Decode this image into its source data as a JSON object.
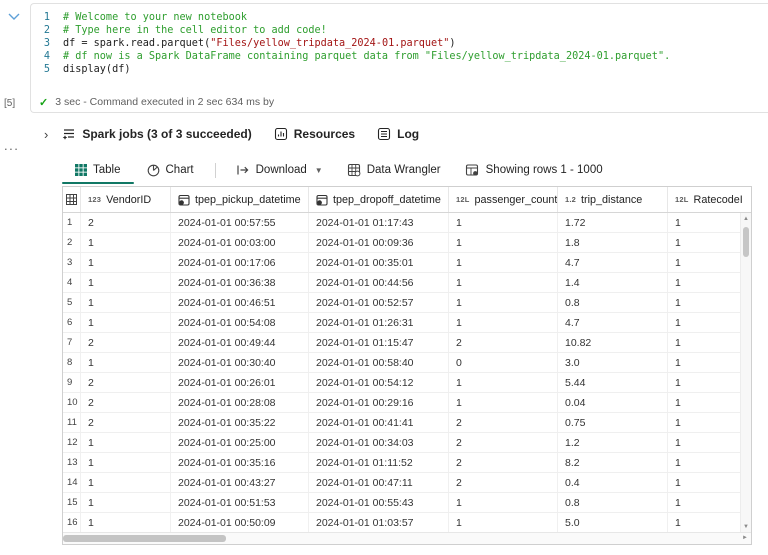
{
  "colors": {
    "accent_green": "#117865",
    "comment_green": "#2e9e2e",
    "string_red": "#a31515",
    "line_number_blue": "#237893",
    "check_green": "#15a315"
  },
  "glyphs": {
    "ellipsis": "...",
    "chevron_right": "›",
    "caret_down": "▼",
    "scroll_up": "▲",
    "scroll_down": "▼",
    "scroll_right": "►"
  },
  "cell": {
    "execution_count": "[5]",
    "lines": [
      {
        "n": "1",
        "parts": [
          {
            "text": "# Welcome to your new notebook",
            "style": "comment"
          }
        ]
      },
      {
        "n": "2",
        "parts": [
          {
            "text": "# Type here in the cell editor to add code!",
            "style": "comment"
          }
        ]
      },
      {
        "n": "3",
        "parts": [
          {
            "text": "df = spark.read.parquet(",
            "style": "code"
          },
          {
            "text": "\"Files/yellow_tripdata_2024-01.parquet\"",
            "style": "string"
          },
          {
            "text": ")",
            "style": "code"
          }
        ]
      },
      {
        "n": "4",
        "parts": [
          {
            "text": "# df now is a Spark DataFrame containing parquet data from \"Files/yellow_tripdata_2024-01.parquet\".",
            "style": "comment"
          }
        ]
      },
      {
        "n": "5",
        "parts": [
          {
            "text": "display(df)",
            "style": "code"
          }
        ]
      }
    ],
    "status_text": "3 sec - Command executed in 2 sec 634 ms by"
  },
  "jobs_bar": {
    "spark_jobs_label": "Spark jobs (3 of 3 succeeded)",
    "resources_label": "Resources",
    "log_label": "Log"
  },
  "output_toolbar": {
    "table_tab": "Table",
    "chart_tab": "Chart",
    "download_label": "Download",
    "data_wrangler_label": "Data Wrangler",
    "rows_status": "Showing rows 1 - 1000"
  },
  "table": {
    "columns": [
      {
        "name": "VendorID",
        "type_badge": "123",
        "icon": ""
      },
      {
        "name": "tpep_pickup_datetime",
        "type_badge": "",
        "icon": "calendar-clock-icon"
      },
      {
        "name": "tpep_dropoff_datetime",
        "type_badge": "",
        "icon": "calendar-clock-icon"
      },
      {
        "name": "passenger_count",
        "type_badge": "12L",
        "icon": ""
      },
      {
        "name": "trip_distance",
        "type_badge": "1.2",
        "icon": ""
      },
      {
        "name": "RatecodeID",
        "type_badge": "12L",
        "icon": ""
      }
    ],
    "rows": [
      [
        "2",
        "2024-01-01 00:57:55",
        "2024-01-01 01:17:43",
        "1",
        "1.72",
        "1"
      ],
      [
        "1",
        "2024-01-01 00:03:00",
        "2024-01-01 00:09:36",
        "1",
        "1.8",
        "1"
      ],
      [
        "1",
        "2024-01-01 00:17:06",
        "2024-01-01 00:35:01",
        "1",
        "4.7",
        "1"
      ],
      [
        "1",
        "2024-01-01 00:36:38",
        "2024-01-01 00:44:56",
        "1",
        "1.4",
        "1"
      ],
      [
        "1",
        "2024-01-01 00:46:51",
        "2024-01-01 00:52:57",
        "1",
        "0.8",
        "1"
      ],
      [
        "1",
        "2024-01-01 00:54:08",
        "2024-01-01 01:26:31",
        "1",
        "4.7",
        "1"
      ],
      [
        "2",
        "2024-01-01 00:49:44",
        "2024-01-01 01:15:47",
        "2",
        "10.82",
        "1"
      ],
      [
        "1",
        "2024-01-01 00:30:40",
        "2024-01-01 00:58:40",
        "0",
        "3.0",
        "1"
      ],
      [
        "2",
        "2024-01-01 00:26:01",
        "2024-01-01 00:54:12",
        "1",
        "5.44",
        "1"
      ],
      [
        "2",
        "2024-01-01 00:28:08",
        "2024-01-01 00:29:16",
        "1",
        "0.04",
        "1"
      ],
      [
        "2",
        "2024-01-01 00:35:22",
        "2024-01-01 00:41:41",
        "2",
        "0.75",
        "1"
      ],
      [
        "1",
        "2024-01-01 00:25:00",
        "2024-01-01 00:34:03",
        "2",
        "1.2",
        "1"
      ],
      [
        "1",
        "2024-01-01 00:35:16",
        "2024-01-01 01:11:52",
        "2",
        "8.2",
        "1"
      ],
      [
        "1",
        "2024-01-01 00:43:27",
        "2024-01-01 00:47:11",
        "2",
        "0.4",
        "1"
      ],
      [
        "1",
        "2024-01-01 00:51:53",
        "2024-01-01 00:55:43",
        "1",
        "0.8",
        "1"
      ],
      [
        "1",
        "2024-01-01 00:50:09",
        "2024-01-01 01:03:57",
        "1",
        "5.0",
        "1"
      ]
    ]
  }
}
